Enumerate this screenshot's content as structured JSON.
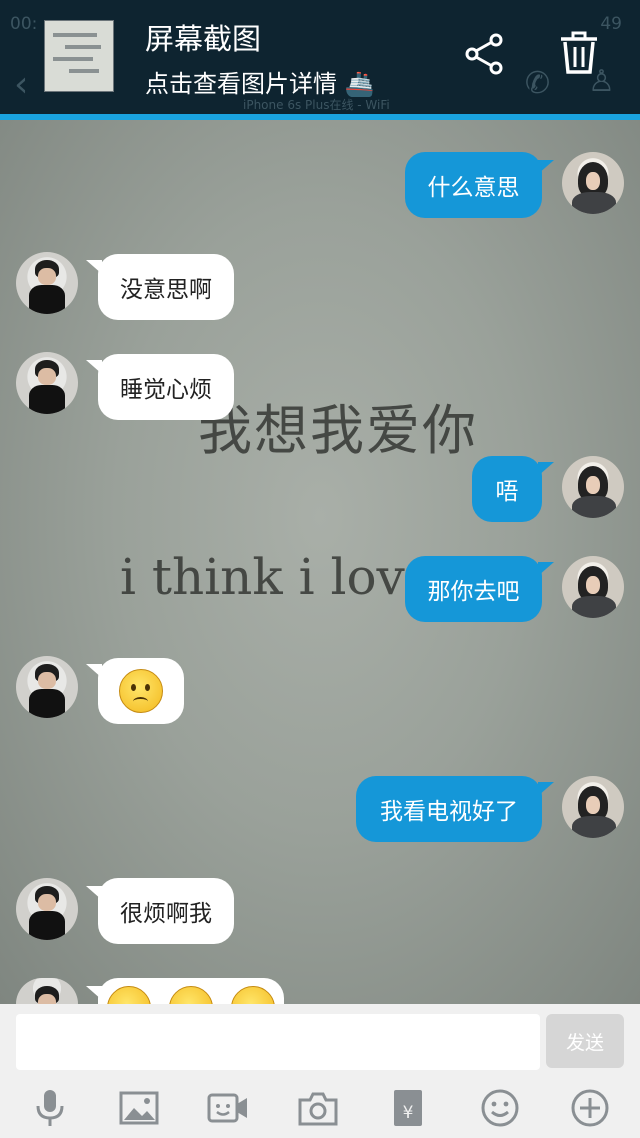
{
  "ghost_status": {
    "time": "00:",
    "battery": "49",
    "subtitle": "iPhone 6s Plus在线 - WiFi"
  },
  "banner": {
    "title": "屏幕截图",
    "subtitle": "点击查看图片详情 🚢"
  },
  "wallpaper": {
    "line1": "我想我爱你",
    "line2": "i think i lov"
  },
  "messages": [
    {
      "side": "out",
      "text": "什么意思"
    },
    {
      "side": "in",
      "text": "没意思啊"
    },
    {
      "side": "in",
      "text": "睡觉心烦"
    },
    {
      "side": "out",
      "text": "唔"
    },
    {
      "side": "out",
      "text": "那你去吧"
    },
    {
      "side": "in",
      "emoji": "frown-emoji"
    },
    {
      "side": "out",
      "text": "我看电视好了"
    },
    {
      "side": "in",
      "text": "很烦啊我"
    },
    {
      "side": "in",
      "emoji": "partial-emoji-row"
    }
  ],
  "input": {
    "placeholder": "",
    "send_label": "发送"
  },
  "toolbar": [
    "microphone-icon",
    "image-icon",
    "video-icon",
    "camera-icon",
    "red-packet-icon",
    "emoji-icon",
    "plus-icon"
  ],
  "colors": {
    "header": "#0e2430",
    "accent": "#1aa3df",
    "bubble_out": "#1597d8",
    "bubble_in": "#ffffff"
  }
}
